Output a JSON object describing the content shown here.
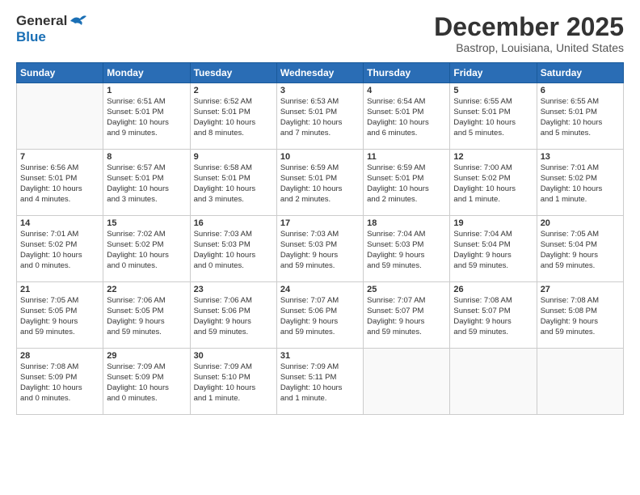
{
  "header": {
    "logo": {
      "general": "General",
      "blue": "Blue"
    },
    "title": "December 2025",
    "subtitle": "Bastrop, Louisiana, United States"
  },
  "calendar": {
    "days_of_week": [
      "Sunday",
      "Monday",
      "Tuesday",
      "Wednesday",
      "Thursday",
      "Friday",
      "Saturday"
    ],
    "weeks": [
      [
        {
          "day": "",
          "details": ""
        },
        {
          "day": "1",
          "details": "Sunrise: 6:51 AM\nSunset: 5:01 PM\nDaylight: 10 hours\nand 9 minutes."
        },
        {
          "day": "2",
          "details": "Sunrise: 6:52 AM\nSunset: 5:01 PM\nDaylight: 10 hours\nand 8 minutes."
        },
        {
          "day": "3",
          "details": "Sunrise: 6:53 AM\nSunset: 5:01 PM\nDaylight: 10 hours\nand 7 minutes."
        },
        {
          "day": "4",
          "details": "Sunrise: 6:54 AM\nSunset: 5:01 PM\nDaylight: 10 hours\nand 6 minutes."
        },
        {
          "day": "5",
          "details": "Sunrise: 6:55 AM\nSunset: 5:01 PM\nDaylight: 10 hours\nand 5 minutes."
        },
        {
          "day": "6",
          "details": "Sunrise: 6:55 AM\nSunset: 5:01 PM\nDaylight: 10 hours\nand 5 minutes."
        }
      ],
      [
        {
          "day": "7",
          "details": "Sunrise: 6:56 AM\nSunset: 5:01 PM\nDaylight: 10 hours\nand 4 minutes."
        },
        {
          "day": "8",
          "details": "Sunrise: 6:57 AM\nSunset: 5:01 PM\nDaylight: 10 hours\nand 3 minutes."
        },
        {
          "day": "9",
          "details": "Sunrise: 6:58 AM\nSunset: 5:01 PM\nDaylight: 10 hours\nand 3 minutes."
        },
        {
          "day": "10",
          "details": "Sunrise: 6:59 AM\nSunset: 5:01 PM\nDaylight: 10 hours\nand 2 minutes."
        },
        {
          "day": "11",
          "details": "Sunrise: 6:59 AM\nSunset: 5:01 PM\nDaylight: 10 hours\nand 2 minutes."
        },
        {
          "day": "12",
          "details": "Sunrise: 7:00 AM\nSunset: 5:02 PM\nDaylight: 10 hours\nand 1 minute."
        },
        {
          "day": "13",
          "details": "Sunrise: 7:01 AM\nSunset: 5:02 PM\nDaylight: 10 hours\nand 1 minute."
        }
      ],
      [
        {
          "day": "14",
          "details": "Sunrise: 7:01 AM\nSunset: 5:02 PM\nDaylight: 10 hours\nand 0 minutes."
        },
        {
          "day": "15",
          "details": "Sunrise: 7:02 AM\nSunset: 5:02 PM\nDaylight: 10 hours\nand 0 minutes."
        },
        {
          "day": "16",
          "details": "Sunrise: 7:03 AM\nSunset: 5:03 PM\nDaylight: 10 hours\nand 0 minutes."
        },
        {
          "day": "17",
          "details": "Sunrise: 7:03 AM\nSunset: 5:03 PM\nDaylight: 9 hours\nand 59 minutes."
        },
        {
          "day": "18",
          "details": "Sunrise: 7:04 AM\nSunset: 5:03 PM\nDaylight: 9 hours\nand 59 minutes."
        },
        {
          "day": "19",
          "details": "Sunrise: 7:04 AM\nSunset: 5:04 PM\nDaylight: 9 hours\nand 59 minutes."
        },
        {
          "day": "20",
          "details": "Sunrise: 7:05 AM\nSunset: 5:04 PM\nDaylight: 9 hours\nand 59 minutes."
        }
      ],
      [
        {
          "day": "21",
          "details": "Sunrise: 7:05 AM\nSunset: 5:05 PM\nDaylight: 9 hours\nand 59 minutes."
        },
        {
          "day": "22",
          "details": "Sunrise: 7:06 AM\nSunset: 5:05 PM\nDaylight: 9 hours\nand 59 minutes."
        },
        {
          "day": "23",
          "details": "Sunrise: 7:06 AM\nSunset: 5:06 PM\nDaylight: 9 hours\nand 59 minutes."
        },
        {
          "day": "24",
          "details": "Sunrise: 7:07 AM\nSunset: 5:06 PM\nDaylight: 9 hours\nand 59 minutes."
        },
        {
          "day": "25",
          "details": "Sunrise: 7:07 AM\nSunset: 5:07 PM\nDaylight: 9 hours\nand 59 minutes."
        },
        {
          "day": "26",
          "details": "Sunrise: 7:08 AM\nSunset: 5:07 PM\nDaylight: 9 hours\nand 59 minutes."
        },
        {
          "day": "27",
          "details": "Sunrise: 7:08 AM\nSunset: 5:08 PM\nDaylight: 9 hours\nand 59 minutes."
        }
      ],
      [
        {
          "day": "28",
          "details": "Sunrise: 7:08 AM\nSunset: 5:09 PM\nDaylight: 10 hours\nand 0 minutes."
        },
        {
          "day": "29",
          "details": "Sunrise: 7:09 AM\nSunset: 5:09 PM\nDaylight: 10 hours\nand 0 minutes."
        },
        {
          "day": "30",
          "details": "Sunrise: 7:09 AM\nSunset: 5:10 PM\nDaylight: 10 hours\nand 1 minute."
        },
        {
          "day": "31",
          "details": "Sunrise: 7:09 AM\nSunset: 5:11 PM\nDaylight: 10 hours\nand 1 minute."
        },
        {
          "day": "",
          "details": ""
        },
        {
          "day": "",
          "details": ""
        },
        {
          "day": "",
          "details": ""
        }
      ]
    ]
  }
}
